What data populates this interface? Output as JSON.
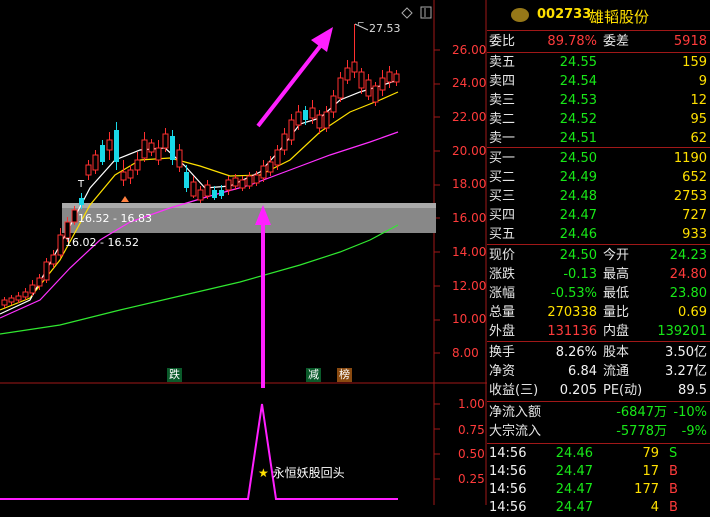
{
  "chart": {
    "price_labels": [
      "26.00",
      "24.00",
      "22.00",
      "20.00",
      "18.00",
      "16.00",
      "14.00",
      "12.00",
      "10.00",
      "8.00"
    ],
    "indicator_labels": [
      "1.00",
      "0.75",
      "0.50",
      "0.25"
    ],
    "high_marker": "27.53",
    "band_label_1": "16.52 - 16.83",
    "band_label_2": "16.02 - 16.52",
    "tag_die": "跌",
    "tag_jian": "减",
    "tag_bang": "榜",
    "t_marker": "T",
    "signal_label": "永恒妖股回头",
    "star": "★",
    "colors": {
      "up": "#ff3030",
      "down": "#18d8e8",
      "ma5": "#ffffff",
      "ma10": "#ffe000",
      "ma20": "#ff30ff",
      "ma60": "#30e830",
      "grid_border": "#a01818",
      "arrow": "#ff20ff"
    }
  },
  "quote": {
    "code": "002733",
    "name": "雄韬股份",
    "weibi_label": "委比",
    "weibi_value": "89.78%",
    "weicha_label": "委差",
    "weicha_value": "5918",
    "sell": [
      {
        "label": "卖五",
        "price": "24.55",
        "vol": "159"
      },
      {
        "label": "卖四",
        "price": "24.54",
        "vol": "9"
      },
      {
        "label": "卖三",
        "price": "24.53",
        "vol": "12"
      },
      {
        "label": "卖二",
        "price": "24.52",
        "vol": "95"
      },
      {
        "label": "卖一",
        "price": "24.51",
        "vol": "62"
      }
    ],
    "buy": [
      {
        "label": "买一",
        "price": "24.50",
        "vol": "1190"
      },
      {
        "label": "买二",
        "price": "24.49",
        "vol": "652"
      },
      {
        "label": "买三",
        "price": "24.48",
        "vol": "2753"
      },
      {
        "label": "买四",
        "price": "24.47",
        "vol": "727"
      },
      {
        "label": "买五",
        "price": "24.46",
        "vol": "933"
      }
    ],
    "stats": [
      {
        "l1": "现价",
        "v1": "24.50",
        "c1": "green",
        "l2": "今开",
        "v2": "24.23",
        "c2": "green"
      },
      {
        "l1": "涨跌",
        "v1": "-0.13",
        "c1": "green",
        "l2": "最高",
        "v2": "24.80",
        "c2": "red"
      },
      {
        "l1": "涨幅",
        "v1": "-0.53%",
        "c1": "green",
        "l2": "最低",
        "v2": "23.80",
        "c2": "green"
      },
      {
        "l1": "总量",
        "v1": "270338",
        "c1": "yellow",
        "l2": "量比",
        "v2": "0.69",
        "c2": "yellow"
      },
      {
        "l1": "外盘",
        "v1": "131136",
        "c1": "red",
        "l2": "内盘",
        "v2": "139201",
        "c2": "green"
      }
    ],
    "stats2": [
      {
        "l1": "换手",
        "v1": "8.26%",
        "l2": "股本",
        "v2": "3.50亿"
      },
      {
        "l1": "净资",
        "v1": "6.84",
        "l2": "流通",
        "v2": "3.27亿"
      },
      {
        "l1": "收益(三)",
        "v1": "0.205",
        "l2": "PE(动)",
        "v2": "89.5"
      }
    ],
    "flow": [
      {
        "label": "净流入额",
        "value": "-6847万",
        "pct": "-10%"
      },
      {
        "label": "大宗流入",
        "value": "-5778万",
        "pct": "-9%"
      }
    ],
    "ticks": [
      {
        "time": "14:56",
        "price": "24.46",
        "vol": "79",
        "side": "S"
      },
      {
        "time": "14:56",
        "price": "24.47",
        "vol": "17",
        "side": "B"
      },
      {
        "time": "14:56",
        "price": "24.47",
        "vol": "177",
        "side": "B"
      },
      {
        "time": "14:56",
        "price": "24.47",
        "vol": "4",
        "side": "B"
      }
    ]
  }
}
